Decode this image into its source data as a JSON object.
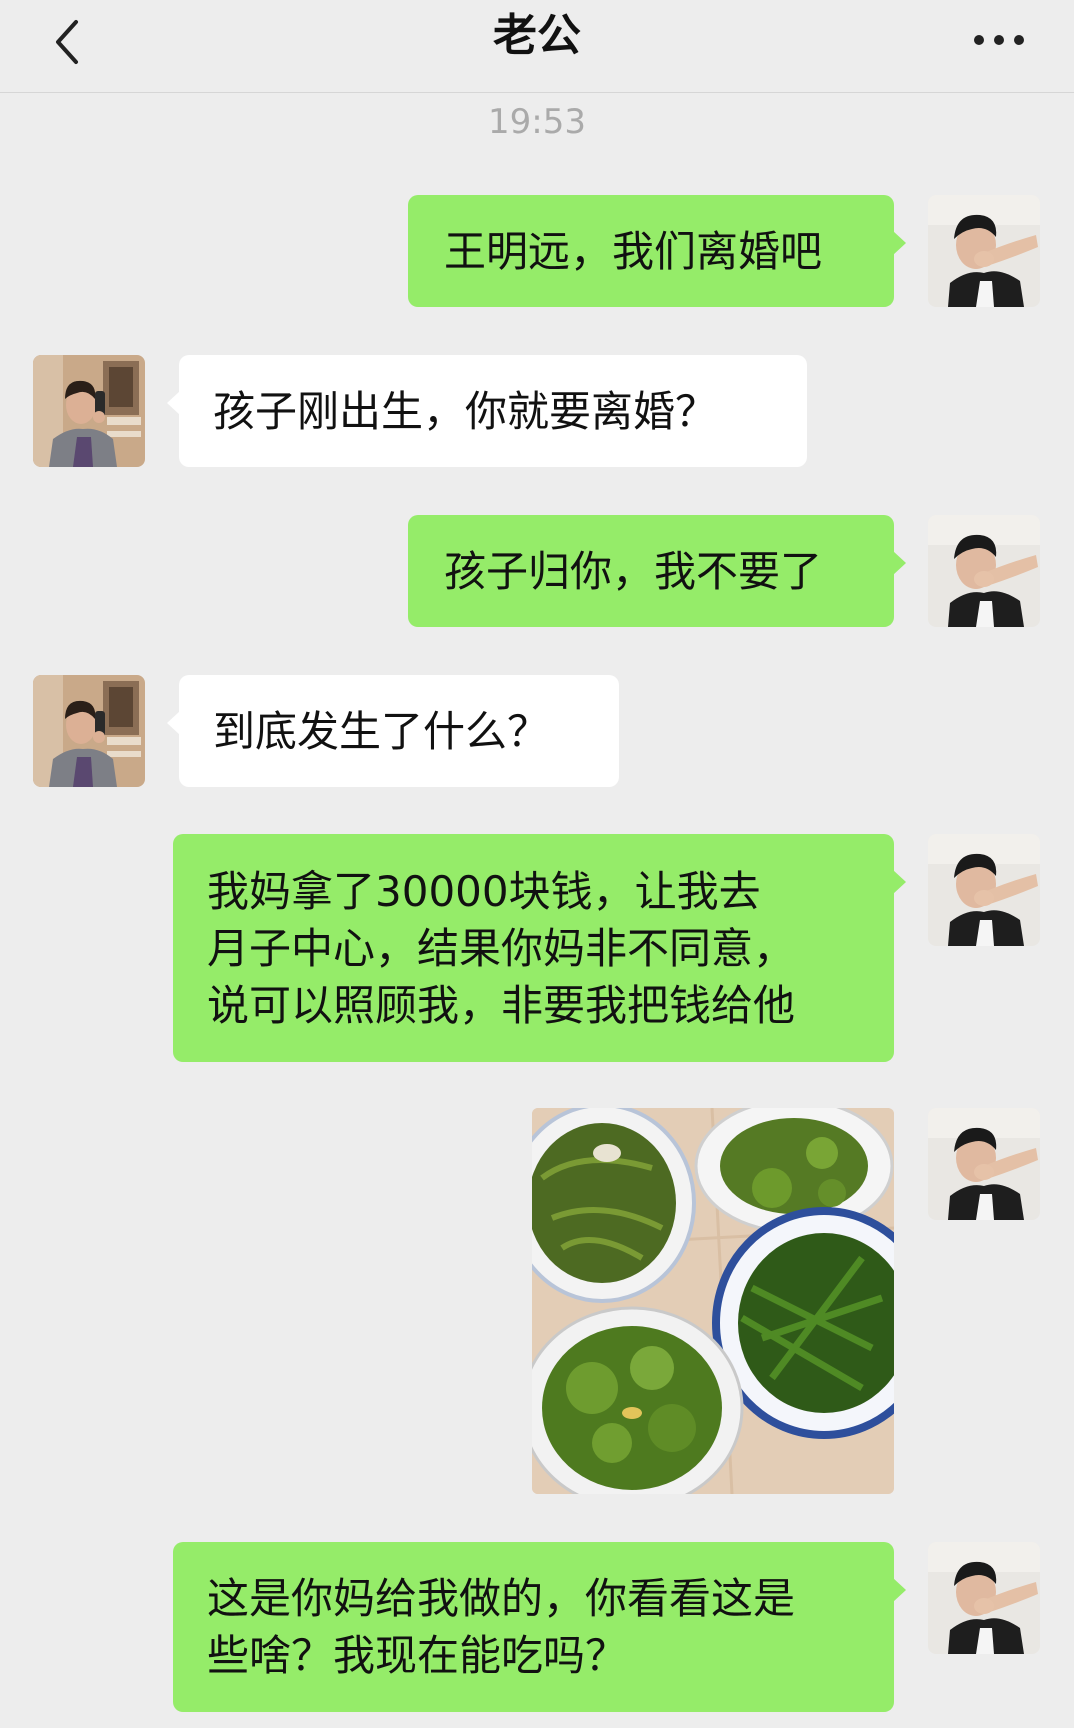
{
  "header": {
    "title": "老公",
    "back_icon": "chevron-left-icon",
    "more_icon": "more-dots-icon"
  },
  "timestamp": "19:53",
  "messages": [
    {
      "sender": "me",
      "type": "text",
      "text": "王明远，我们离婚吧"
    },
    {
      "sender": "other",
      "type": "text",
      "text": "孩子刚出生，你就要离婚？"
    },
    {
      "sender": "me",
      "type": "text",
      "text": "孩子归你，我不要了"
    },
    {
      "sender": "other",
      "type": "text",
      "text": "到底发生了什么？"
    },
    {
      "sender": "me",
      "type": "text",
      "text": "我妈拿了30000块钱，让我去\n月子中心，结果你妈非不同意，\n说可以照顾我，非要我把钱给他"
    },
    {
      "sender": "me",
      "type": "image",
      "description": "photo-of-vegetable-dishes"
    },
    {
      "sender": "me",
      "type": "text",
      "text": "这是你妈给我做的，你看看这是\n些啥？我现在能吃吗？"
    }
  ],
  "colors": {
    "background": "#ededed",
    "my_bubble": "#95ec69",
    "other_bubble": "#ffffff",
    "timestamp": "#aaaaaa"
  }
}
